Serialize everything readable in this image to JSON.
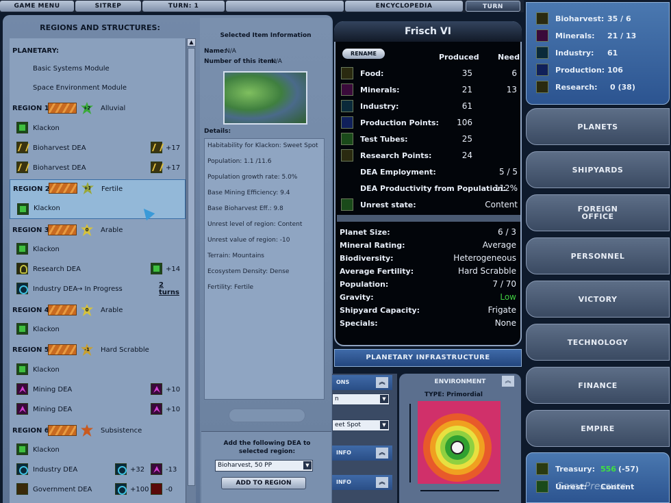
{
  "topmenu": {
    "game_menu": "GAME MENU",
    "sitrep": "SITREP",
    "turn_label": "TURN: 1",
    "encyclopedia": "ENCYCLOPEDIA",
    "turn_button": "TURN"
  },
  "regions_panel": {
    "title": "REGIONS AND STRUCTURES:",
    "planetary": "PLANETARY:",
    "basic_module": "Basic Systems Module",
    "space_module": "Space Environment Module",
    "region1": {
      "label": "REGION 1:",
      "fertility": "+2",
      "type": "Alluvial"
    },
    "klackon": "Klackon",
    "bioharvest": "Bioharvest DEA",
    "plus17": "+17",
    "region2": {
      "label": "REGION 2:",
      "fertility": "+1",
      "type": "Fertile"
    },
    "region3": {
      "label": "REGION 3:",
      "fertility": "0",
      "type": "Arable"
    },
    "research_dea": "Research DEA",
    "plus14": "+14",
    "industry_progress": "Industry DEA",
    "in_progress": "→ In Progress",
    "two_turns": "2 turns",
    "region4": {
      "label": "REGION 4:",
      "fertility": "0",
      "type": "Arable"
    },
    "region5": {
      "label": "REGION 5:",
      "fertility": "-1",
      "type": "Hard Scrabble"
    },
    "mining_dea": "Mining DEA",
    "plus10": "+10",
    "region6": {
      "label": "REGION 6:",
      "fertility": "",
      "type": "Subsistence"
    },
    "industry_dea": "Industry DEA",
    "plus32": "+32",
    "minus13": "-13",
    "government_dea": "Government DEA",
    "plus100": "+100",
    "minus0": "-0"
  },
  "selected_info": {
    "title": "Selected Item Information",
    "name_label": "Name:",
    "name_value": "N/A",
    "number_label": "Number of this item:",
    "number_value": "N/A",
    "details_label": "Details:",
    "details": [
      "Habitability for Klackon: Sweet Spot",
      "Population: 1.1 /11.6",
      "Population growth rate: 5.0%",
      "Base Mining Efficiency: 9.4",
      "Base Bioharvest Eff.: 9.8",
      "Unrest level of region: Content",
      "Unrest value of region: -10",
      "Terrain: Mountains",
      "Ecosystem Density: Dense",
      "Fertility: Fertile"
    ],
    "add_label": "Add the following DEA to selected region:",
    "add_select": "Bioharvest, 50 PP",
    "add_button": "ADD TO REGION"
  },
  "planet": {
    "name": "Frisch VI",
    "rename": "RENAME",
    "produced_header": "Produced",
    "need_header": "Need",
    "rows": [
      {
        "label": "Food:",
        "produced": "35",
        "need": "6"
      },
      {
        "label": "Minerals:",
        "produced": "21",
        "need": "13"
      },
      {
        "label": "Industry:",
        "produced": "61",
        "need": ""
      },
      {
        "label": "Production Points:",
        "produced": "106",
        "need": ""
      },
      {
        "label": "Test Tubes:",
        "produced": "25",
        "need": ""
      },
      {
        "label": "Research Points:",
        "produced": "24",
        "need": ""
      }
    ],
    "dea_employment_label": "DEA Employment:",
    "dea_employment": "5 / 5",
    "dea_productivity_label": "DEA Productivity from Population:",
    "dea_productivity": "112%",
    "unrest_label": "Unrest state:",
    "unrest": "Content",
    "props": [
      {
        "label": "Planet Size:",
        "value": "6 / 3"
      },
      {
        "label": "Mineral Rating:",
        "value": "Average"
      },
      {
        "label": "Biodiversity:",
        "value": "Heterogeneous"
      },
      {
        "label": "Average Fertility:",
        "value": "Hard Scrabble"
      },
      {
        "label": "Population:",
        "value": "7 / 70"
      },
      {
        "label": "Gravity:",
        "value": "Low"
      },
      {
        "label": "Shipyard Capacity:",
        "value": "Frigate"
      },
      {
        "label": "Specials:",
        "value": "None"
      }
    ],
    "infrastructure": "PLANETARY INFRASTRUCTURE",
    "gravity_color": "#40d040"
  },
  "lower": {
    "bar1": "ONS",
    "select1": "n",
    "select2": "eet Spot",
    "bar2": "INFO",
    "bar3": "INFO",
    "environment": "ENVIRONMENT",
    "env_type": "TYPE:  Primordial"
  },
  "empire_stats": [
    {
      "label": "Bioharvest:",
      "value": "35 / 6"
    },
    {
      "label": "Minerals:",
      "value": "21 / 13"
    },
    {
      "label": "Industry:",
      "value": "61"
    },
    {
      "label": "Production:",
      "value": "106"
    },
    {
      "label": "Research:",
      "value": "0 (38)"
    }
  ],
  "nav": [
    "PLANETS",
    "SHIPYARDS",
    "FOREIGN OFFICE",
    "PERSONNEL",
    "VICTORY",
    "TECHNOLOGY",
    "FINANCE",
    "EMPIRE"
  ],
  "treasury": {
    "label": "Treasury:",
    "value": "556",
    "delta": "(-57)",
    "unrest_label": "Unrest:",
    "unrest_value": "Content"
  },
  "watermark": "GamePressure"
}
